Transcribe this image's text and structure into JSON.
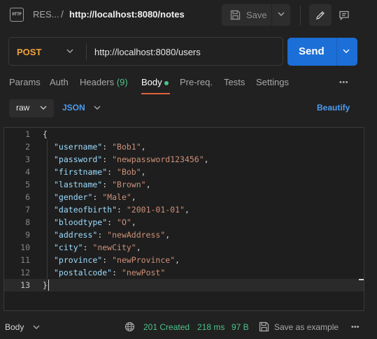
{
  "breadcrumb": {
    "icon": "http-file-icon",
    "icon_text": "HTTP",
    "parent": "RES...",
    "separator": "/",
    "current": "http://localhost:8080/notes"
  },
  "toolbar": {
    "save_label": "Save",
    "save_icon": "floppy-disk-icon",
    "edit_icon": "pencil-icon",
    "comment_icon": "comment-icon"
  },
  "request": {
    "method": "POST",
    "url": "http://localhost:8080/users",
    "send_label": "Send"
  },
  "tabs": [
    {
      "label": "Params"
    },
    {
      "label": "Auth"
    },
    {
      "label": "Headers",
      "count": "(9)"
    },
    {
      "label": "Body",
      "active": true
    },
    {
      "label": "Pre-req."
    },
    {
      "label": "Tests"
    },
    {
      "label": "Settings"
    }
  ],
  "body_options": {
    "mode": "raw",
    "format": "JSON",
    "beautify_label": "Beautify"
  },
  "editor": {
    "line_numbers": [
      "1",
      "2",
      "3",
      "4",
      "5",
      "6",
      "7",
      "8",
      "9",
      "10",
      "11",
      "12",
      "13"
    ],
    "open_brace": "{",
    "close_brace": "}",
    "fields": [
      {
        "key": "\"username\"",
        "value": "\"Bob1\"",
        "comma": ","
      },
      {
        "key": "\"password\"",
        "value": "\"newpassword123456\"",
        "comma": ","
      },
      {
        "key": "\"firstname\"",
        "value": "\"Bob\"",
        "comma": ","
      },
      {
        "key": "\"lastname\"",
        "value": "\"Brown\"",
        "comma": ","
      },
      {
        "key": "\"gender\"",
        "value": "\"Male\"",
        "comma": ","
      },
      {
        "key": "\"dateofbirth\"",
        "value": "\"2001-01-01\"",
        "comma": ","
      },
      {
        "key": "\"bloodtype\"",
        "value": "\"O\"",
        "comma": ","
      },
      {
        "key": "\"address\"",
        "value": "\"newAddress\"",
        "comma": ","
      },
      {
        "key": "\"city\"",
        "value": "\"newCity\"",
        "comma": ","
      },
      {
        "key": "\"province\"",
        "value": "\"newProvince\"",
        "comma": ","
      },
      {
        "key": "\"postalcode\"",
        "value": "\"newPost\"",
        "comma": ""
      }
    ],
    "colon": ": "
  },
  "footer": {
    "body_label": "Body",
    "status": "201 Created",
    "time": "218 ms",
    "size": "97 B",
    "save_example_label": "Save as example"
  },
  "colors": {
    "accent_blue": "#1c6fd6",
    "method_orange": "#f2a13c",
    "success_green": "#4cc38a",
    "active_tab_underline": "#e0623b"
  }
}
